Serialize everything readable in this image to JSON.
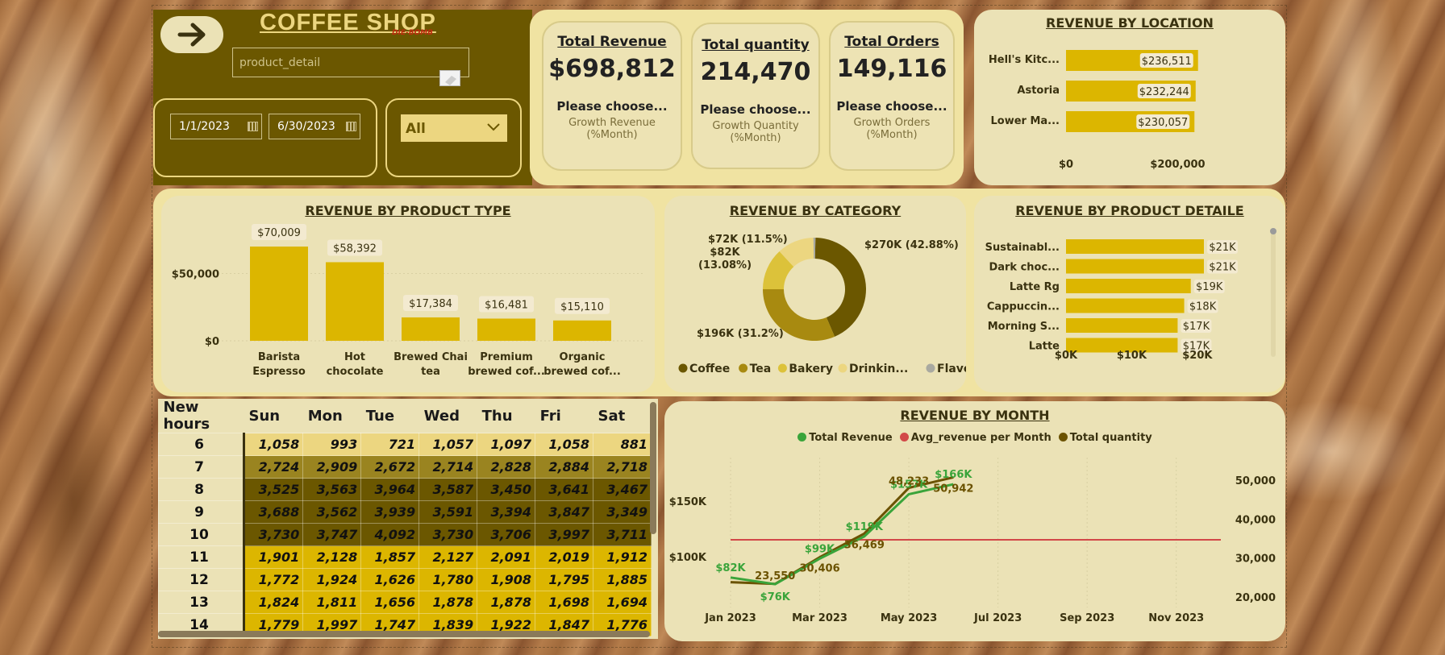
{
  "header": {
    "title": "COFFEE SHOP",
    "back_icon": "arrow-right-icon",
    "search_value": "product_detail",
    "annotation": "DIE-BOMB"
  },
  "filters": {
    "start_date": "1/1/2023",
    "end_date": "6/30/2023",
    "location_select": "All"
  },
  "kpis": [
    {
      "title": "Total Revenue",
      "value": "$698,812",
      "choose": "Please choose...",
      "growth": "Growth Revenue",
      "unit": "(%Month)"
    },
    {
      "title": "Total quantity",
      "value": "214,470",
      "choose": "Please choose...",
      "growth": "Growth Quantity",
      "unit": "(%Month)"
    },
    {
      "title": "Total Orders",
      "value": "149,116",
      "choose": "Please choose...",
      "growth": "Growth Orders",
      "unit": "(%Month)"
    }
  ],
  "colors": {
    "dark": "#6b5700",
    "gold": "#dcb600",
    "panel": "#ebe2b6",
    "green": "#3aa43a",
    "red": "#d24848",
    "brown": "#6b5200"
  },
  "chart_data": [
    {
      "id": "location",
      "type": "bar",
      "orientation": "horizontal",
      "title": "REVENUE BY LOCATION",
      "categories": [
        "Hell's Kitc...",
        "Astoria",
        "Lower Ma..."
      ],
      "values": [
        236511,
        232244,
        230057
      ],
      "data_labels": [
        "$236,511",
        "$232,244",
        "$230,057"
      ],
      "xticks": [
        "$0",
        "$200,000"
      ],
      "xlim": [
        0,
        260000
      ]
    },
    {
      "id": "product_type",
      "type": "bar",
      "title": "REVENUE BY PRODUCT TYPE",
      "categories": [
        [
          "Barista",
          "Espresso"
        ],
        [
          "Hot",
          "chocolate"
        ],
        [
          "Brewed Chai",
          "tea"
        ],
        [
          "Premium",
          "brewed cof..."
        ],
        [
          "Organic",
          "brewed cof..."
        ]
      ],
      "values": [
        70009,
        58392,
        17384,
        16481,
        15110
      ],
      "data_labels": [
        "$70,009",
        "$58,392",
        "$17,384",
        "$16,481",
        "$15,110"
      ],
      "yticks": [
        "$50,000",
        "$0"
      ],
      "ylim": [
        0,
        85000
      ]
    },
    {
      "id": "category",
      "type": "pie",
      "title": "REVENUE BY CATEGORY",
      "slices": [
        {
          "name": "Coffee",
          "value": 270,
          "label": "$270K (42.88%)",
          "color": "#6b5700"
        },
        {
          "name": "Tea",
          "value": 196,
          "label": "$196K (31.2%)",
          "color": "#a88a10"
        },
        {
          "name": "Bakery",
          "value": 82,
          "label": "$82K (13.08%)",
          "color": "#dcc23a"
        },
        {
          "name": "Drinkin...",
          "value": 72,
          "label": "$72K (11.5%)",
          "color": "#ecd680"
        },
        {
          "name": "Flavours",
          "value": 4,
          "label": "",
          "color": "#a9a9a0"
        }
      ]
    },
    {
      "id": "product_detail",
      "type": "bar",
      "orientation": "horizontal",
      "title": "REVENUE BY PRODUCT DETAILE",
      "categories": [
        "Sustainabl...",
        "Dark choc...",
        "Latte Rg",
        "Cappuccin...",
        "Morning S...",
        "Latte"
      ],
      "values": [
        21,
        21,
        19,
        18,
        17,
        17
      ],
      "data_labels": [
        "$21K",
        "$21K",
        "$19K",
        "$18K",
        "$17K",
        "$17K"
      ],
      "xticks": [
        "$0K",
        "$10K",
        "$20K"
      ],
      "xlim": [
        0,
        28
      ]
    },
    {
      "id": "month",
      "type": "line",
      "title": "REVENUE BY MONTH",
      "x": [
        "Jan 2023",
        "Feb 2023",
        "Mar 2023",
        "Apr 2023",
        "May 2023",
        "Jun 2023"
      ],
      "xticks": [
        "Jan 2023",
        "Mar 2023",
        "May 2023",
        "Jul 2023",
        "Sep 2023",
        "Nov 2023"
      ],
      "series": [
        {
          "name": "Total Revenue",
          "axis": "left",
          "values": [
            82,
            76,
            99,
            119,
            157,
            166
          ],
          "labels": [
            "$82K",
            "$76K",
            "$99K",
            "$119K",
            "$157K",
            "$166K"
          ],
          "color": "#3aa43a"
        },
        {
          "name": "Avg_revenue per Month",
          "axis": "left",
          "values": [
            116,
            116,
            116,
            116,
            116,
            116
          ],
          "color": "#d24848"
        },
        {
          "name": "Total quantity",
          "axis": "right",
          "values": [
            24000,
            23550,
            30406,
            36469,
            48233,
            50942
          ],
          "labels": [
            "",
            "23,550",
            "30,406",
            "36,469",
            "48,233",
            "50,942"
          ],
          "color": "#6b5200"
        }
      ],
      "yticks_left": [
        "$150K",
        "$100K"
      ],
      "yticks_right": [
        "50,000",
        "40,000",
        "30,000",
        "20,000"
      ],
      "ylim_left": [
        55,
        190
      ],
      "ylim_right": [
        17500,
        56000
      ]
    }
  ],
  "heatmap": {
    "headers": [
      "New hours",
      "Sun",
      "Mon",
      "Tue",
      "Wed",
      "Thu",
      "Fri",
      "Sat"
    ],
    "rows": [
      {
        "hour": "6",
        "values": [
          "1,058",
          "993",
          "721",
          "1,057",
          "1,097",
          "1,058",
          "881"
        ]
      },
      {
        "hour": "7",
        "values": [
          "2,724",
          "2,909",
          "2,672",
          "2,714",
          "2,828",
          "2,884",
          "2,718"
        ]
      },
      {
        "hour": "8",
        "values": [
          "3,525",
          "3,563",
          "3,964",
          "3,587",
          "3,450",
          "3,641",
          "3,467"
        ]
      },
      {
        "hour": "9",
        "values": [
          "3,688",
          "3,562",
          "3,939",
          "3,591",
          "3,394",
          "3,847",
          "3,349"
        ]
      },
      {
        "hour": "10",
        "values": [
          "3,730",
          "3,747",
          "4,092",
          "3,730",
          "3,706",
          "3,997",
          "3,711"
        ]
      },
      {
        "hour": "11",
        "values": [
          "1,901",
          "2,128",
          "1,857",
          "2,127",
          "2,091",
          "2,019",
          "1,912"
        ]
      },
      {
        "hour": "12",
        "values": [
          "1,772",
          "1,924",
          "1,626",
          "1,780",
          "1,908",
          "1,795",
          "1,885"
        ]
      },
      {
        "hour": "13",
        "values": [
          "1,824",
          "1,811",
          "1,656",
          "1,878",
          "1,878",
          "1,698",
          "1,694"
        ]
      },
      {
        "hour": "14",
        "values": [
          "1,779",
          "1,997",
          "1,747",
          "1,839",
          "1,922",
          "1,847",
          "1,776"
        ]
      }
    ]
  }
}
